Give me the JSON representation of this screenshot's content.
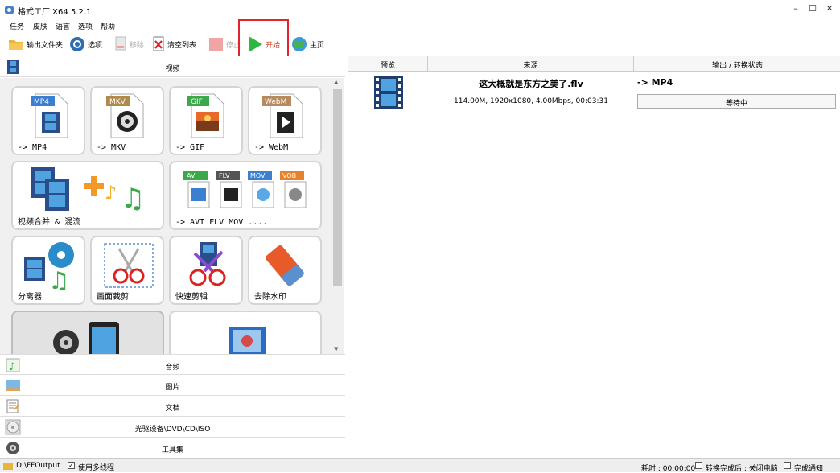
{
  "window": {
    "title": "格式工厂 X64 5.2.1",
    "minimize": "–",
    "maximize": "☐",
    "close": "✕"
  },
  "menu": [
    "任务",
    "皮肤",
    "语言",
    "选项",
    "帮助"
  ],
  "toolbar": {
    "output_folder": "输出文件夹",
    "options": "选项",
    "remove": "移除",
    "clear_list": "清空列表",
    "stop": "停止",
    "start": "开始",
    "home": "主页"
  },
  "left": {
    "video_header": "视频",
    "tiles": [
      {
        "label": "-> MP4",
        "badge": "MP4",
        "badge_color": "#3b7fd0"
      },
      {
        "label": "-> MKV",
        "badge": "MKV",
        "badge_color": "#b08a4a"
      },
      {
        "label": "-> GIF",
        "badge": "GIF",
        "badge_color": "#3aa84b"
      },
      {
        "label": "-> WebM",
        "badge": "WebM",
        "badge_color": "#b68a5c"
      },
      {
        "label": "视频合并 & 混流"
      },
      {
        "label": "-> AVI FLV MOV ....",
        "badges": [
          "AVI",
          "FLV",
          "MOV",
          "VOB"
        ]
      },
      {
        "label": "分离器"
      },
      {
        "label": "画面裁剪"
      },
      {
        "label": "快速剪辑"
      },
      {
        "label": "去除水印"
      }
    ],
    "categories": [
      "音频",
      "图片",
      "文档",
      "光驱设备\\DVD\\CD\\ISO",
      "工具集"
    ]
  },
  "task_list": {
    "headers": {
      "preview": "预览",
      "source": "来源",
      "output": "输出 / 转换状态"
    },
    "items": [
      {
        "filename": "这大概就是东方之美了.flv",
        "info": "114.00M, 1920x1080, 4.00Mbps, 00:03:31",
        "target": "-> MP4",
        "status": "等待中"
      }
    ]
  },
  "status": {
    "output_path": "D:\\FFOutput",
    "multithread": "使用多线程",
    "elapsed": "耗时 : 00:00:00",
    "after_convert": "转换完成后 : 关闭电脑",
    "notify": "完成通知"
  },
  "colors": {
    "start_green": "#2fb640",
    "highlight": "#e4242a"
  }
}
